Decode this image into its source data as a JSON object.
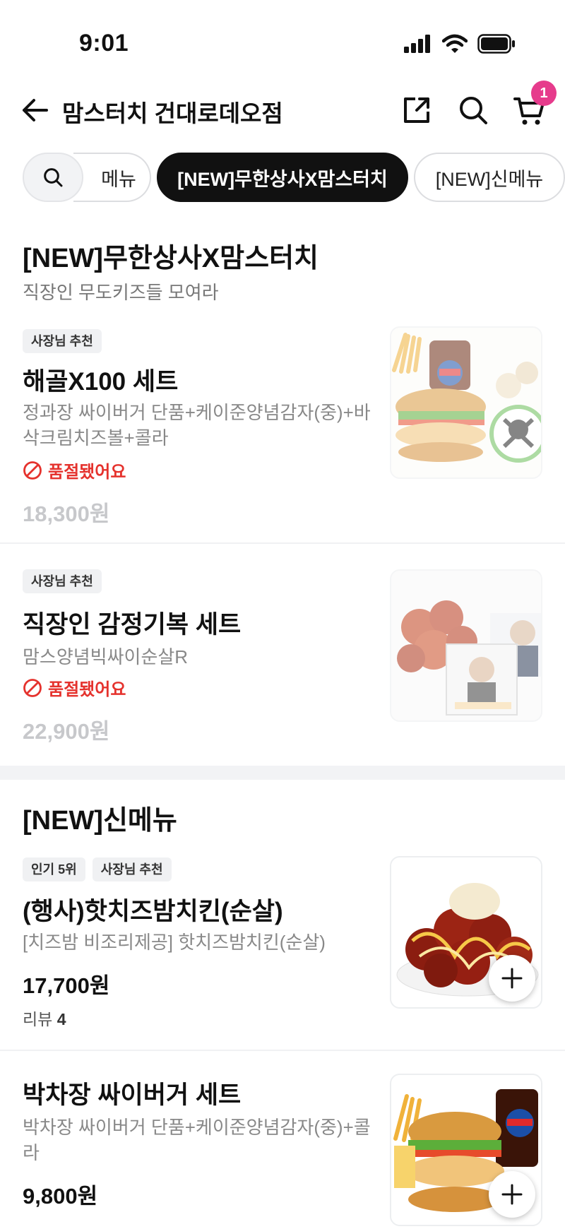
{
  "status": {
    "time": "9:01"
  },
  "header": {
    "store_name": "맘스터치 건대로데오점",
    "cart_count": "1"
  },
  "tabs": {
    "menu": "메뉴",
    "active": "[NEW]무한상사X맘스터치",
    "new_menu": "[NEW]신메뉴"
  },
  "section1": {
    "title": "[NEW]무한상사X맘스터치",
    "subtitle": "직장인 무도키즈들 모여라",
    "items": [
      {
        "badges": [
          "사장님 추천"
        ],
        "name": "해골X100 세트",
        "desc": "정과장 싸이버거 단품+케이준양념감자(중)+바삭크림치즈볼+콜라",
        "status": "품절됐어요",
        "price": "18,300원"
      },
      {
        "badges": [
          "사장님 추천"
        ],
        "name": "직장인 감정기복 세트",
        "desc": "맘스양념빅싸이순살R",
        "status": "품절됐어요",
        "price": "22,900원"
      }
    ]
  },
  "section2": {
    "title": "[NEW]신메뉴",
    "items": [
      {
        "badges": [
          "인기 5위",
          "사장님 추천"
        ],
        "name": "(행사)핫치즈밤치킨(순살)",
        "desc": "[치즈밤 비조리제공] 핫치즈밤치킨(순살)",
        "price": "17,700원",
        "review_label": "리뷰",
        "review_count": "4"
      },
      {
        "name": "박차장 싸이버거 세트",
        "desc": "박차장 싸이버거 단품+케이준양념감자(중)+콜라",
        "price": "9,800원"
      }
    ]
  },
  "colors": {
    "soldout_red": "#e5322d",
    "badge_pink": "#e63b8c",
    "active_tab": "#111111"
  }
}
